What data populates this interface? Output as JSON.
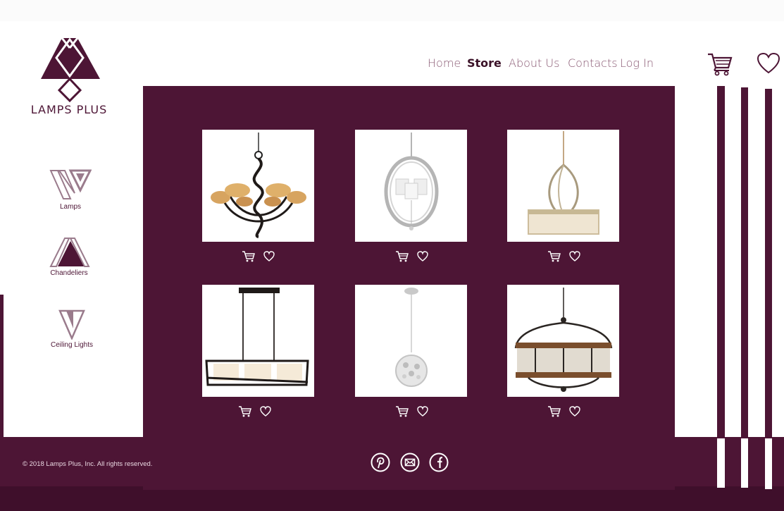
{
  "brand": {
    "name": "LAMPS PLUS"
  },
  "nav": {
    "items": [
      "Home",
      "Store",
      "About Us",
      "Contacts",
      "Log In"
    ],
    "active": "Store"
  },
  "header_icons": {
    "cart": "cart-icon",
    "wishlist": "heart-icon"
  },
  "categories": [
    {
      "label": "Lamps",
      "icon": "lamps-category-icon"
    },
    {
      "label": "Chandeliers",
      "icon": "chandeliers-category-icon"
    },
    {
      "label": "Ceiling Lights",
      "icon": "ceiling-lights-category-icon"
    }
  ],
  "products": [
    {
      "image": "swirl-chandelier-amber-shades",
      "actions": [
        "cart-icon",
        "heart-icon"
      ]
    },
    {
      "image": "orb-chandelier-crystal",
      "actions": [
        "cart-icon",
        "heart-icon"
      ]
    },
    {
      "image": "drum-pendant-cage",
      "actions": [
        "cart-icon",
        "heart-icon"
      ]
    },
    {
      "image": "linear-island-pendant",
      "actions": [
        "cart-icon",
        "heart-icon"
      ]
    },
    {
      "image": "crystal-sphere-pendant",
      "actions": [
        "cart-icon",
        "heart-icon"
      ]
    },
    {
      "image": "wood-drum-chandelier",
      "actions": [
        "cart-icon",
        "heart-icon"
      ]
    }
  ],
  "footer": {
    "copyright": "© 2018 Lamps Plus, Inc. All rights reserved.",
    "social": [
      "pinterest-icon",
      "mail-icon",
      "facebook-icon"
    ]
  },
  "colors": {
    "brand": "#4d1535",
    "nav_text": "#8a5a74",
    "footer_text": "#e8d6e0"
  }
}
